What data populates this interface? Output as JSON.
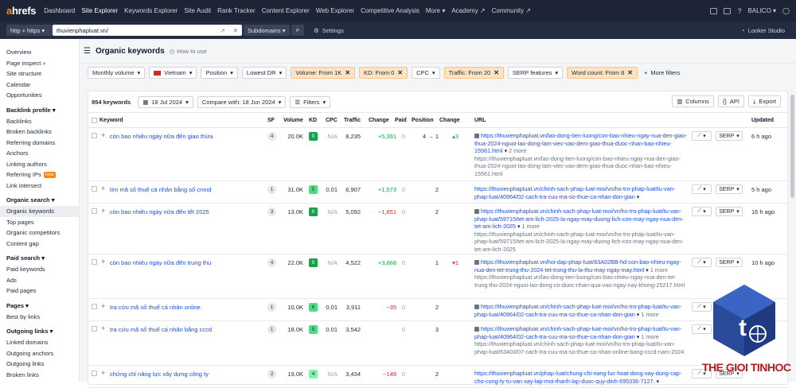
{
  "topnav": {
    "logo_a": "a",
    "logo_rest": "hrefs",
    "items": [
      "Dashboard",
      "Site Explorer",
      "Keywords Explorer",
      "Site Audit",
      "Rank Tracker",
      "Content Explorer",
      "Web Explorer",
      "Competitive Analysis",
      "More ▾",
      "Academy ↗",
      "Community ↗"
    ],
    "active": "Site Explorer",
    "account": "BALICO ▾"
  },
  "subbar": {
    "protocol": "http + https ▾",
    "target": "thuvienphapluat.vn/",
    "mode": "Subdomains ▾",
    "settings": "Settings",
    "looker": "Looker Studio"
  },
  "sidebar": {
    "top": [
      "Overview",
      "Page inspect",
      "Site structure",
      "Calendar",
      "Opportunities"
    ],
    "sections": [
      {
        "head": "Backlink profile ▾",
        "items": [
          "Backlinks",
          "Broken backlinks",
          "Referring domains",
          "Anchors",
          "Linking authors",
          "Referring IPs",
          "Link intersect"
        ],
        "new_on": "Referring IPs",
        "new_label": "New"
      },
      {
        "head": "Organic search ▾",
        "items": [
          "Organic keywords",
          "Top pages",
          "Organic competitors",
          "Content gap"
        ]
      },
      {
        "head": "Paid search ▾",
        "items": [
          "Paid keywords",
          "Ads",
          "Paid pages"
        ]
      },
      {
        "head": "Pages ▾",
        "items": [
          "Best by links"
        ]
      },
      {
        "head": "Outgoing links ▾",
        "items": [
          "Linked domains",
          "Outgoing anchors",
          "Outgoing links",
          "Broken links"
        ]
      }
    ],
    "selected": "Organic keywords"
  },
  "page": {
    "title": "Organic keywords",
    "howto": "How to use"
  },
  "filters": [
    {
      "label": "Monthly volume",
      "on": false
    },
    {
      "label": "Vietnam",
      "on": false
    },
    {
      "label": "Position",
      "on": false
    },
    {
      "label": "Lowest DR",
      "on": false
    },
    {
      "label": "Volume: From 1K",
      "on": true
    },
    {
      "label": "KD: From 0",
      "on": true
    },
    {
      "label": "CPC",
      "on": false
    },
    {
      "label": "Traffic: From 20",
      "on": true
    },
    {
      "label": "SERP features",
      "on": false
    },
    {
      "label": "Word count: From 8",
      "on": true
    }
  ],
  "more_filters": "More filters",
  "controls": {
    "count": "954 keywords",
    "date": "18 Jul 2024",
    "compare": "Compare with: 18 Jun 2024",
    "filters": "Filters",
    "columns": "Columns",
    "api": "API",
    "export": "Export"
  },
  "columns": [
    "Keyword",
    "SF",
    "Volume",
    "KD",
    "CPC",
    "Traffic",
    "Change",
    "Paid",
    "Position",
    "Change",
    "URL",
    "Updated"
  ],
  "rows": [
    {
      "kw": "còn bao nhiêu ngày nữa đến giao thừa",
      "sf": "4",
      "vol": "20.0K",
      "kd": "0",
      "kdc": "g0",
      "cpc": "N/A",
      "traffic": "8,235",
      "change": "+5,391",
      "chc": "pos",
      "paid": "0",
      "pos": "4 → 1",
      "pchg": "▴3",
      "pchc": "pos",
      "url": "https://thuvienphapluat.vn/lao-dong-tien-luong/con-bao-nhieu-ngay-nua-den-giao-thua-2024-nguoi-lao-dong-lam-viec-vao-dem-giao-thua-duoc-nhan-bao-nhieu-15561.html",
      "url_more": "2 more",
      "url2": "https://thuvienphapluat.vn/lao-dong-tien-luong/con-bao-nhieu-ngay-nua-den-giao-thua-2024-nguoi-lao-dong-lam-viec-vao-dem-giao-thua-duoc-nhan-bao-nhieu-15561.html",
      "upd": "6 h ago",
      "h": 67
    },
    {
      "kw": "tìm mã số thuế cá nhân bằng số cmnd",
      "sf": "1",
      "vol": "31.0K",
      "kd": "5",
      "kdc": "g5",
      "cpc": "0.01",
      "traffic": "6,907",
      "change": "+1,573",
      "chc": "pos",
      "paid": "0",
      "pos": "2",
      "pchg": "",
      "pchc": "",
      "url": "https://thuvienphapluat.vn/chinh-sach-phap-luat-moi/vn/ho-tro-phap-luat/tu-van-phap-luat/40964/02-cach-tra-cuu-ma-so-thue-ca-nhan-don-gian",
      "url_more": "",
      "url2": "",
      "upd": "5 h ago",
      "h": 28
    },
    {
      "kw": "còn bao nhiêu ngày nữa đến tết 2025",
      "sf": "3",
      "vol": "13.0K",
      "kd": "0",
      "kdc": "g0",
      "cpc": "N/A",
      "traffic": "5,092",
      "change": "−1,651",
      "chc": "neg",
      "paid": "0",
      "pos": "2",
      "pchg": "",
      "pchc": "",
      "url": "https://thuvienphapluat.vn/chinh-sach-phap-luat-moi/vn/ho-tro-phap-luat/tu-van-phap-luat/59715/tet-am-lich-2025-la-ngay-may-duong-lich-con-may-ngay-nua-den-tet-am-lich-2025",
      "url_more": "1 more",
      "url2": "https://thuvienphapluat.vn/chinh-sach-phap-luat-moi/vn/ho-tro-phap-luat/tu-van-phap-luat/59715/tet-am-lich-2025-la-ngay-may-duong-lich-con-may-ngay-nua-den-tet-am-lich-2025",
      "upd": "16 h ago",
      "h": 64
    },
    {
      "kw": "còn bao nhiêu ngày nữa đến trung thu",
      "sf": "4",
      "vol": "22.0K",
      "kd": "0",
      "kdc": "g0",
      "cpc": "N/A",
      "traffic": "4,522",
      "change": "+3,668",
      "chc": "pos",
      "paid": "0",
      "pos": "1",
      "pchg": "▾1",
      "pchc": "neg",
      "url": "https://thuvienphapluat.vn/hoi-dap-phap-luat/83A02BB-hd-con-bao-nhieu-ngay-nua-den-tet-trung-thu-2024-tet-trung-thu-la-thu-may-ngay-may.html",
      "url_more": "1 more",
      "url2": "https://thuvienphapluat.vn/lao-dong-tien-luong/con-bao-nhieu-ngay-nua-den-tet-trung-thu-2024-nguoi-lao-dong-co-duoc-nhan-qua-vao-ngay-nay-khong-25217.html",
      "upd": "10 h ago",
      "h": 56
    },
    {
      "kw": "tra cứu mã số thuế cá nhân online",
      "sf": "1",
      "vol": "10.0K",
      "kd": "6",
      "kdc": "g6",
      "cpc": "0.01",
      "traffic": "3,911",
      "change": "−35",
      "chc": "neg",
      "paid": "0",
      "pos": "2",
      "pchg": "",
      "pchc": "",
      "url": "https://thuvienphapluat.vn/chinh-sach-phap-luat-moi/vn/ho-tro-phap-luat/tu-van-phap-luat/40964/02-cach-tra-cuu-ma-so-thue-ca-nhan-don-gian",
      "url_more": "1 more",
      "url2": "",
      "upd": "",
      "h": 28
    },
    {
      "kw": "tra cứu mã số thuế cá nhân bằng cccd",
      "sf": "1",
      "vol": "18.0K",
      "kd": "5",
      "kdc": "g5",
      "cpc": "0.01",
      "traffic": "3,542",
      "change": "",
      "chc": "",
      "paid": "0",
      "pos": "3",
      "pchg": "",
      "pchc": "",
      "url": "https://thuvienphapluat.vn/chinh-sach-phap-luat-moi/vn/ho-tro-phap-luat/tu-van-phap-luat/40964/02-cach-tra-cuu-ma-so-thue-ca-nhan-don-gian",
      "url_more": "1 more",
      "url2": "https://thuvienphapluat.vn/chinh-sach-phap-luat-moi/vn/ho-tro-phap-luat/tu-van-phap-luat/63403/07-cach-tra-cuu-ma-so-thue-ca-nhan-online-bang-cccd-nam-2024",
      "upd": "",
      "h": 56
    },
    {
      "kw": "chứng chỉ năng lực xây dựng công ty",
      "sf": "2",
      "vol": "19.0K",
      "kd": "4",
      "kdc": "g4",
      "cpc": "N/A",
      "traffic": "3,434",
      "change": "−149",
      "chc": "neg",
      "paid": "0",
      "pos": "2",
      "pchg": "",
      "pchc": "",
      "url": "https://thuvienphapluat.vn/phap-luat/chung-chi-nang-luc-hoat-dong-xay-dung-cap-cho-cong-ty-tu-van-xay-lap-moi-thanh-lap-duoc-quy-dinh-695336-7127.",
      "url_more": "",
      "url2": "",
      "upd": "",
      "h": 28
    }
  ],
  "watermark": {
    "brand": "THE GIOI TINHOC"
  },
  "colors": {
    "nav": "#1c2436",
    "accent": "#ff8800",
    "filter_on": "#fde3c2",
    "link": "#1d4ed8"
  }
}
